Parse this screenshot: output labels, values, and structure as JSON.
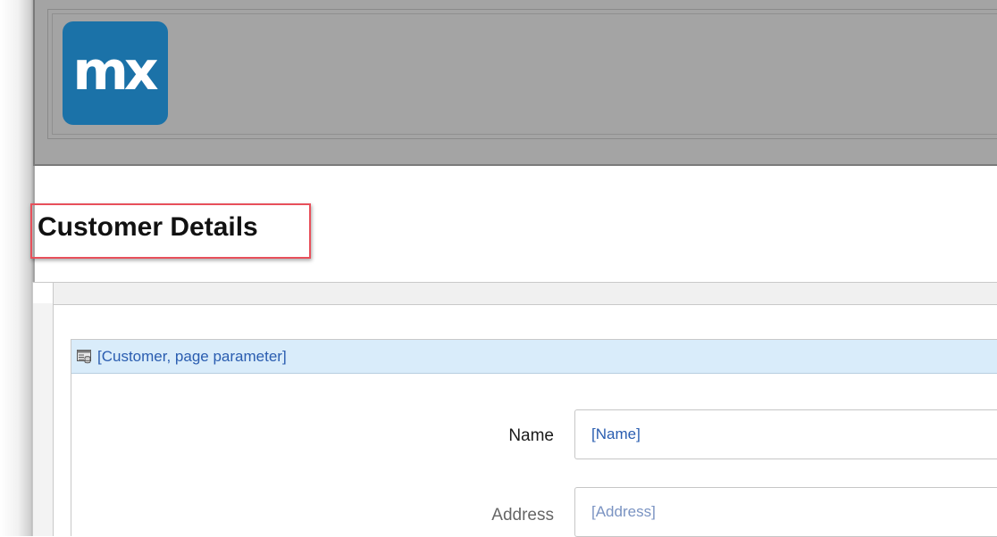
{
  "header": {
    "logo_text": "mx",
    "logo_color": "#1b72a8",
    "background": "#a4a4a4"
  },
  "page": {
    "title": "Customer Details",
    "highlight_color": "#e8505b"
  },
  "dataview": {
    "icon": "dataview-icon",
    "label": "[Customer, page parameter]",
    "header_color": "#d9ecfa"
  },
  "fields": [
    {
      "label": "Name",
      "value": "[Name]"
    },
    {
      "label": "Address",
      "value": "[Address]"
    }
  ]
}
